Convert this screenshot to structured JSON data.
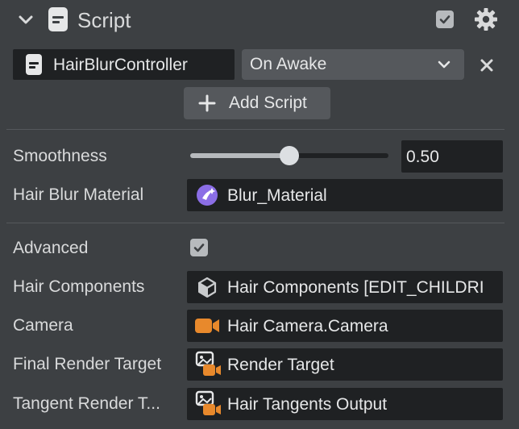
{
  "header": {
    "title": "Script",
    "enabled": true
  },
  "script_row": {
    "script_name": "HairBlurController",
    "event_dropdown": "On Awake"
  },
  "add_script_button": "Add Script",
  "properties": {
    "smoothness": {
      "label": "Smoothness",
      "value_text": "0.50",
      "slider_value": 0.5
    },
    "hair_blur_material": {
      "label": "Hair Blur Material",
      "value": "Blur_Material"
    },
    "advanced": {
      "label": "Advanced",
      "checked": true
    },
    "hair_components": {
      "label": "Hair Components",
      "value": "Hair Components [EDIT_CHILDRI"
    },
    "camera": {
      "label": "Camera",
      "value": "Hair Camera.Camera"
    },
    "final_render_target": {
      "label": "Final Render Target",
      "value": "Render Target"
    },
    "tangent_render_target": {
      "label": "Tangent Render T...",
      "value": "Hair Tangents Output"
    }
  },
  "colors": {
    "panel_bg": "#3d4043",
    "field_bg": "#1f2123",
    "accent_orange": "#e8892c",
    "material_purple": "#8b6ee6",
    "checkbox_fill": "#b7babd"
  },
  "icons": {
    "collapse": "chevron-down-icon",
    "script": "script-file-icon",
    "settings": "gear-icon",
    "remove": "close-icon",
    "add": "plus-icon",
    "material": "material-icon",
    "scene_object": "scene-object-icon",
    "camera": "camera-icon",
    "render_target": "render-target-icon"
  }
}
